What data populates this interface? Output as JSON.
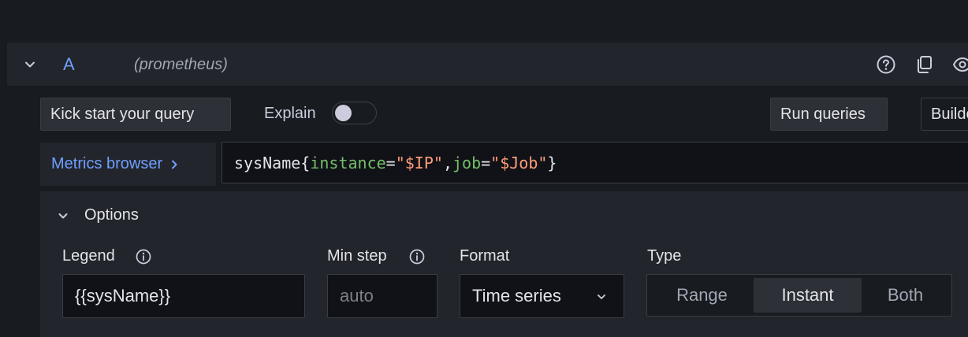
{
  "query": {
    "ref_id": "A",
    "datasource": "(prometheus)",
    "header_icons": [
      "help-icon",
      "duplicate-icon",
      "eye-icon"
    ]
  },
  "toolbar": {
    "kick_start_label": "Kick start your query",
    "explain_label": "Explain",
    "explain_enabled": false,
    "run_queries_label": "Run queries",
    "builder_label": "Builder"
  },
  "editor": {
    "metrics_browser_label": "Metrics browser",
    "expression": {
      "metric": "sysName",
      "open_brace": "{",
      "label1": "instance",
      "eq1": "=",
      "value1": "\"$IP\"",
      "comma": ",",
      "label2": "job",
      "eq2": "=",
      "value2": "\"$Job\"",
      "close_brace": "}"
    }
  },
  "options": {
    "title": "Options",
    "legend": {
      "label": "Legend",
      "value": "{{sysName}}"
    },
    "min_step": {
      "label": "Min step",
      "placeholder": "auto"
    },
    "format": {
      "label": "Format",
      "value": "Time series"
    },
    "type": {
      "label": "Type",
      "options": [
        "Range",
        "Instant",
        "Both"
      ],
      "selected": "Instant"
    }
  },
  "colors": {
    "accent_blue": "#6e9fff",
    "label_green": "#73bf69",
    "string_orange": "#ff9c7a"
  }
}
